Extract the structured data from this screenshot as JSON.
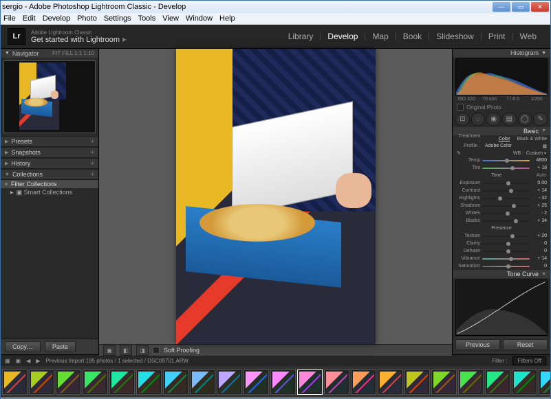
{
  "window": {
    "title": "sergio - Adobe Photoshop Lightroom Classic - Develop"
  },
  "menus": [
    "File",
    "Edit",
    "Develop",
    "Photo",
    "Settings",
    "Tools",
    "View",
    "Window",
    "Help"
  ],
  "branding": {
    "subtitle": "Adobe Lightroom Classic",
    "title": "Get started with Lightroom"
  },
  "modules": [
    "Library",
    "Develop",
    "Map",
    "Book",
    "Slideshow",
    "Print",
    "Web"
  ],
  "active_module": "Develop",
  "navigator": {
    "title": "Navigator",
    "modes": "FIT   FILL   1:1   1:10"
  },
  "left_panels": [
    "Presets",
    "Snapshots",
    "History",
    "Collections"
  ],
  "collections": {
    "filter": "Filter Collections",
    "smart": "Smart Collections"
  },
  "copy_paste": {
    "copy": "Copy…",
    "paste": "Paste"
  },
  "toolbar": {
    "soft_proof": "Soft Proofing"
  },
  "prev_reset": {
    "prev": "Previous",
    "reset": "Reset"
  },
  "histogram": {
    "title": "Histogram",
    "iso": "ISO 320",
    "focal": "70 mm",
    "aperture": "f / 8.0",
    "shutter": "1/200",
    "orig": "Original Photo"
  },
  "basic": {
    "title": "Basic",
    "treatment": "Treatment :",
    "color": "Color",
    "bw": "Black & White",
    "profile_lbl": "Profile :",
    "profile": "Adobe Color",
    "wb_lbl": "WB :",
    "wb": "Custom",
    "temp": {
      "lbl": "Temp",
      "val": "4800",
      "pos": 48
    },
    "tint": {
      "lbl": "Tint",
      "val": "+ 18",
      "pos": 60
    },
    "tone": "Tone",
    "auto": "Auto",
    "exposure": {
      "lbl": "Exposure",
      "val": "0.00",
      "pos": 50
    },
    "contrast": {
      "lbl": "Contrast",
      "val": "+ 14",
      "pos": 57
    },
    "highlights": {
      "lbl": "Highlights",
      "val": "- 32",
      "pos": 34
    },
    "shadows": {
      "lbl": "Shadows",
      "val": "+ 25",
      "pos": 62
    },
    "whites": {
      "lbl": "Whites",
      "val": "- 2",
      "pos": 49
    },
    "blacks": {
      "lbl": "Blacks",
      "val": "+ 34",
      "pos": 67
    },
    "presence": "Presence",
    "texture": {
      "lbl": "Texture",
      "val": "+ 20",
      "pos": 60
    },
    "clarity": {
      "lbl": "Clarity",
      "val": "0",
      "pos": 50
    },
    "dehaze": {
      "lbl": "Dehaze",
      "val": "0",
      "pos": 50
    },
    "vibrance": {
      "lbl": "Vibrance",
      "val": "+ 14",
      "pos": 57
    },
    "saturation": {
      "lbl": "Saturation",
      "val": "0",
      "pos": 50
    }
  },
  "tone_curve": "Tone Curve",
  "filmstrip": {
    "status": "Previous Import     195 photos / 1 selected  / DSC09701.ARW",
    "filter_lbl": "Filter :",
    "filter": "Filters Off",
    "count": 21,
    "selected": 11
  }
}
